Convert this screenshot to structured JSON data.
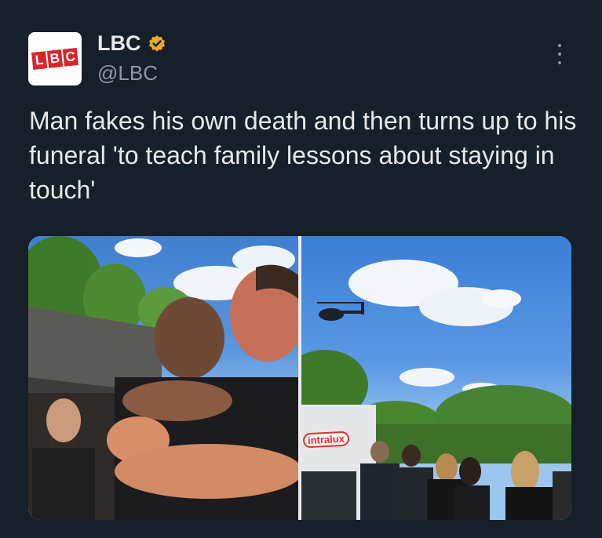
{
  "account": {
    "avatar_logo": [
      "L",
      "B",
      "C"
    ],
    "display_name": "LBC",
    "handle": "@LBC",
    "verified_icon": "verified-badge-icon",
    "brand_color": "#d8262e",
    "badge_color": "#e8a82c"
  },
  "tweet": {
    "text": "Man fakes his own death and then turns up to his funeral 'to teach family lessons about staying in touch'"
  },
  "media": {
    "right_photo_sign": "intralux"
  },
  "icons": {
    "more": "more-options-icon"
  }
}
